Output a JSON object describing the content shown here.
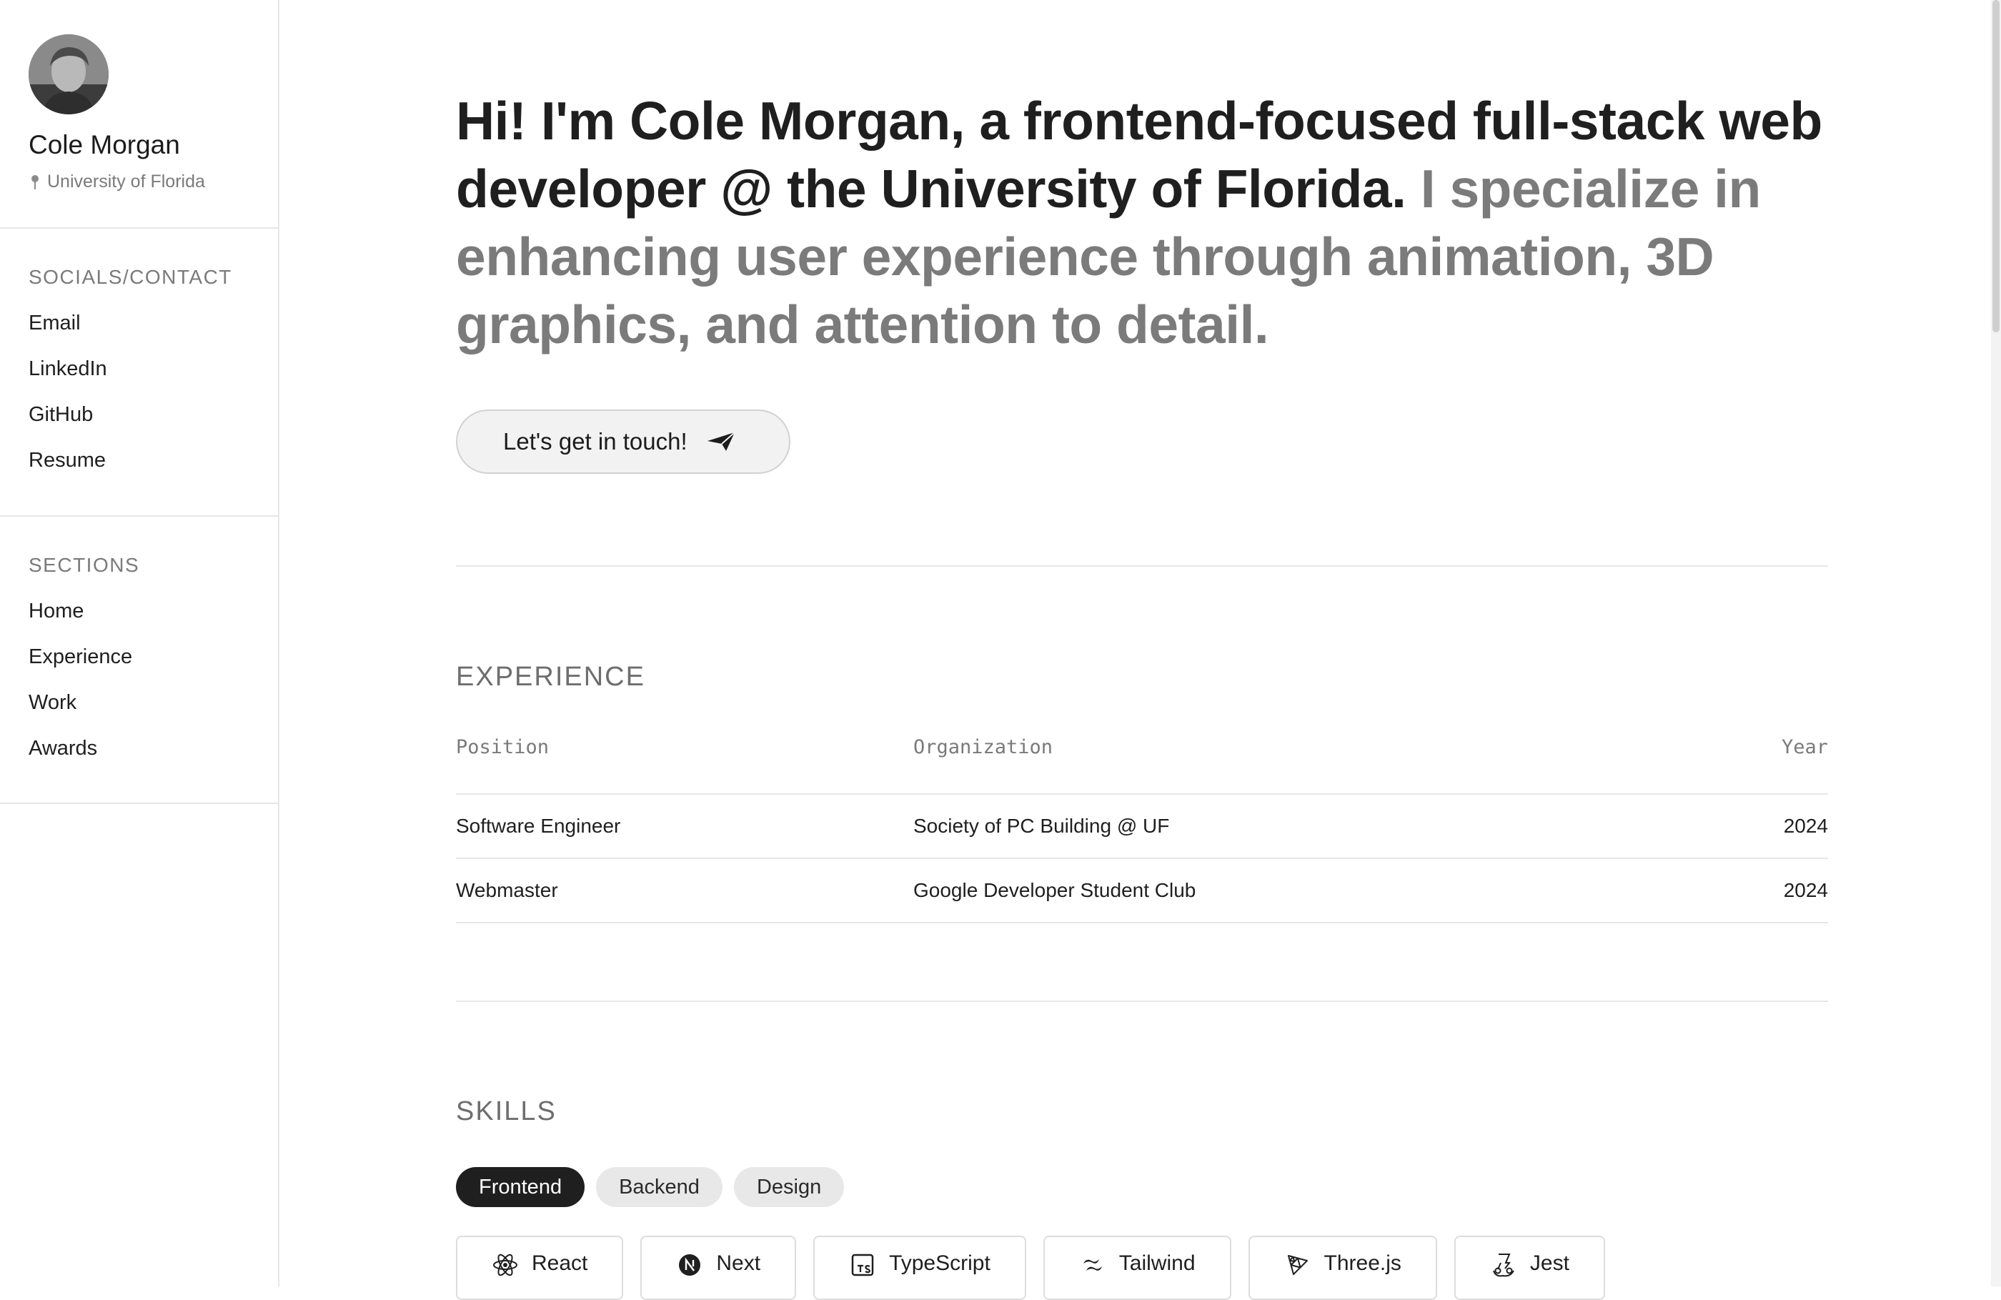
{
  "profile": {
    "name": "Cole Morgan",
    "location": "University of Florida"
  },
  "sidebar": {
    "socials_heading": "SOCIALS/CONTACT",
    "socials": [
      {
        "label": "Email"
      },
      {
        "label": "LinkedIn"
      },
      {
        "label": "GitHub"
      },
      {
        "label": "Resume"
      }
    ],
    "sections_heading": "SECTIONS",
    "sections": [
      {
        "label": "Home"
      },
      {
        "label": "Experience"
      },
      {
        "label": "Work"
      },
      {
        "label": "Awards"
      }
    ]
  },
  "hero": {
    "headline": "Hi! I'm Cole Morgan, a frontend-focused full-stack web developer @ the University of Florida.",
    "subline": "I specialize in enhancing user experience through animation, 3D graphics, and attention to detail.",
    "cta_label": "Let's get in touch!"
  },
  "experience": {
    "title": "EXPERIENCE",
    "columns": [
      "Position",
      "Organization",
      "Year"
    ],
    "rows": [
      {
        "position": "Software Engineer",
        "organization": "Society of PC Building @ UF",
        "year": "2024"
      },
      {
        "position": "Webmaster",
        "organization": "Google Developer Student Club",
        "year": "2024"
      }
    ]
  },
  "skills": {
    "title": "SKILLS",
    "tabs": [
      {
        "label": "Frontend",
        "active": true
      },
      {
        "label": "Backend",
        "active": false
      },
      {
        "label": "Design",
        "active": false
      }
    ],
    "items": [
      {
        "label": "React",
        "icon": "react-icon"
      },
      {
        "label": "Next",
        "icon": "nextjs-icon"
      },
      {
        "label": "TypeScript",
        "icon": "typescript-icon"
      },
      {
        "label": "Tailwind",
        "icon": "tailwind-icon"
      },
      {
        "label": "Three.js",
        "icon": "threejs-icon"
      },
      {
        "label": "Jest",
        "icon": "jest-icon"
      }
    ]
  },
  "colors": {
    "text_primary": "#1f1f1f",
    "text_muted": "#7b7b7b",
    "active_tab_bg": "#1f1f1f",
    "inactive_tab_bg": "#e8e8e8",
    "border": "#e6e6e6"
  }
}
